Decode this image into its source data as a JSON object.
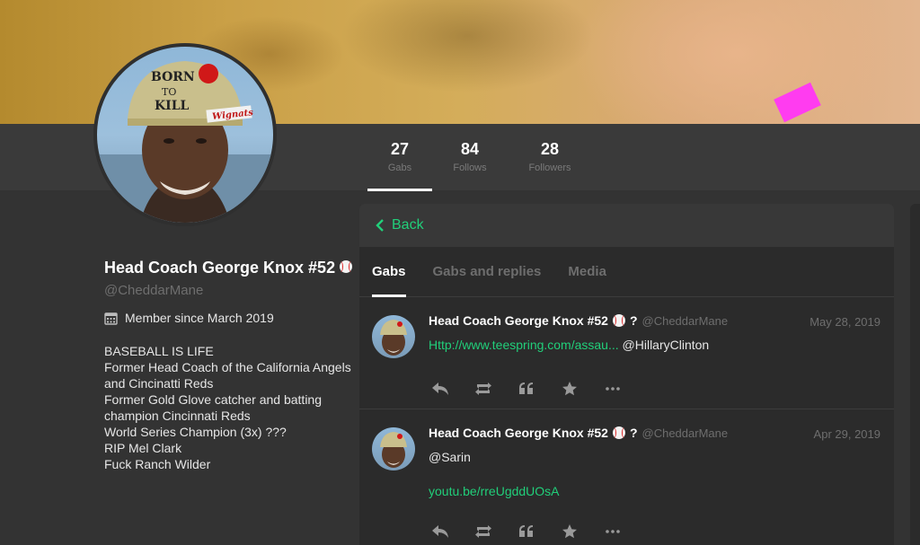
{
  "banner": {
    "icon": "cover-photo"
  },
  "stats": [
    {
      "value": "27",
      "label": "Gabs"
    },
    {
      "value": "84",
      "label": "Follows"
    },
    {
      "value": "28",
      "label": "Followers"
    }
  ],
  "profile": {
    "avatar_hat_text": "BORN TO KILL",
    "avatar_band_text": "Wignats",
    "name": "Head Coach George Knox #52",
    "handle": "@CheddarMane",
    "member_since": "Member since March 2019",
    "bio": "BASEBALL IS LIFE\nFormer Head Coach of the California Angels\nand Cincinatti Reds\nFormer Gold Glove catcher and batting\nchampion Cincinnati Reds\nWorld Series Champion (3x) ???\nRIP Mel Clark\nFuck Ranch Wilder"
  },
  "panel": {
    "back_label": "Back",
    "tabs": [
      {
        "label": "Gabs",
        "active": true
      },
      {
        "label": "Gabs and replies",
        "active": false
      },
      {
        "label": "Media",
        "active": false
      }
    ]
  },
  "posts": [
    {
      "name": "Head Coach George Knox #52",
      "suffix": "?",
      "handle": "@CheddarMane",
      "date": "May 28, 2019",
      "link": "Http://www.teespring.com/assau...",
      "mention": "@HillaryClinton"
    },
    {
      "name": "Head Coach George Knox #52",
      "suffix": "?",
      "handle": "@CheddarMane",
      "date": "Apr 29, 2019",
      "text": "@Sarin",
      "link": "youtu.be/rreUgddUOsA"
    }
  ],
  "colors": {
    "accent": "#21cf7a",
    "bg": "#333333",
    "panel": "#2b2b2b"
  }
}
